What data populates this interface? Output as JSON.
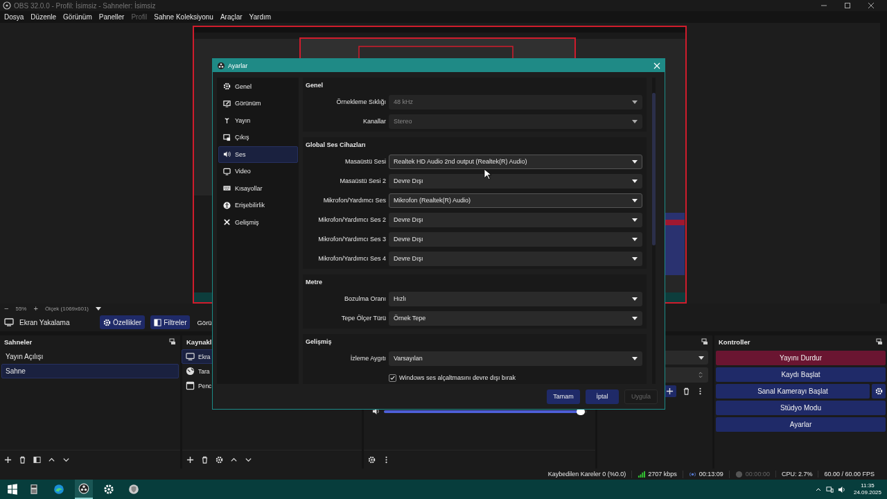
{
  "window": {
    "title": "OBS 32.0.0 - Profil: İsimsiz - Sahneler: İsimsiz"
  },
  "menu": [
    {
      "label": "Dosya",
      "disabled": false
    },
    {
      "label": "Düzenle",
      "disabled": false
    },
    {
      "label": "Görünüm",
      "disabled": false
    },
    {
      "label": "Paneller",
      "disabled": false
    },
    {
      "label": "Profil",
      "disabled": true
    },
    {
      "label": "Sahne Koleksiyonu",
      "disabled": false
    },
    {
      "label": "Araçlar",
      "disabled": false
    },
    {
      "label": "Yardım",
      "disabled": false
    }
  ],
  "preview": {
    "zoom_out": "−",
    "zoom": "55%",
    "zoom_in": "+",
    "scale": "Ölçek (1069x601)"
  },
  "source_toolbar": {
    "source": "Ekran Yakalama",
    "buttons": [
      {
        "label": "Özellikler",
        "kind": "gear"
      },
      {
        "label": "Filtreler",
        "kind": "filter"
      },
      {
        "label": "Görü",
        "kind": "plain"
      }
    ]
  },
  "scenes": {
    "title": "Sahneler",
    "items": [
      {
        "label": "Yayın Açılışı",
        "selected": false
      },
      {
        "label": "Sahne",
        "selected": true
      }
    ]
  },
  "sources": {
    "title": "Kaynakl",
    "items": [
      {
        "label": "Ekra",
        "kind": "display",
        "selected": true
      },
      {
        "label": "Tara",
        "kind": "browser",
        "selected": false
      },
      {
        "label": "Penc",
        "kind": "window",
        "selected": false
      }
    ]
  },
  "mixer": {
    "level": 0.97
  },
  "controls": {
    "title": "Kontroller",
    "buttons": [
      {
        "label": "Yayını Durdur",
        "active": true,
        "settings": false
      },
      {
        "label": "Kaydı Başlat",
        "active": false,
        "settings": false
      },
      {
        "label": "Sanal Kamerayı Başlat",
        "active": false,
        "settings": true
      },
      {
        "label": "Stüdyo Modu",
        "active": false,
        "settings": false
      },
      {
        "label": "Ayarlar",
        "active": false,
        "settings": false
      }
    ]
  },
  "status_bar": {
    "dropped": "Kaybedilen Kareler 0 (%0.0)",
    "bitrate": "2707 kbps",
    "stream_time": "00:13:09",
    "record_time": "00:00:00",
    "cpu": "CPU: 2.7%",
    "fps": "60.00 / 60.00 FPS"
  },
  "taskbar": {
    "apps": [
      {
        "kind": "calculator",
        "selected": false
      },
      {
        "kind": "edge",
        "selected": false
      },
      {
        "kind": "obs",
        "selected": true
      },
      {
        "kind": "settings",
        "selected": false
      },
      {
        "kind": "shield",
        "selected": false
      }
    ],
    "time": "11:35",
    "date": "24.09.2025"
  },
  "settings_dialog": {
    "title": "Ayarlar",
    "nav": [
      {
        "label": "Genel",
        "kind": "gear",
        "selected": false
      },
      {
        "label": "Görünüm",
        "kind": "appearance",
        "selected": false
      },
      {
        "label": "Yayın",
        "kind": "antenna",
        "selected": false
      },
      {
        "label": "Çıkış",
        "kind": "output",
        "selected": false
      },
      {
        "label": "Ses",
        "kind": "speaker",
        "selected": true
      },
      {
        "label": "Video",
        "kind": "monitor",
        "selected": false
      },
      {
        "label": "Kısayollar",
        "kind": "keyboard",
        "selected": false
      },
      {
        "label": "Erişebilirlik",
        "kind": "access",
        "selected": false
      },
      {
        "label": "Gelişmiş",
        "kind": "tools",
        "selected": false
      }
    ],
    "sections": [
      {
        "title": "Genel",
        "rows": [
          {
            "kind": "select",
            "label": "Örnekleme Sıklığı",
            "value": "48 kHz",
            "disabled": true,
            "highlighted": false
          },
          {
            "kind": "select",
            "label": "Kanallar",
            "value": "Stereo",
            "disabled": true,
            "highlighted": false
          }
        ]
      },
      {
        "title": "Global Ses Cihazları",
        "rows": [
          {
            "kind": "select",
            "label": "Masaüstü Sesi",
            "value": "Realtek HD Audio 2nd output (Realtek(R) Audio)",
            "disabled": false,
            "highlighted": true
          },
          {
            "kind": "select",
            "label": "Masaüstü Sesi 2",
            "value": "Devre Dışı",
            "disabled": false,
            "highlighted": false
          },
          {
            "kind": "select",
            "label": "Mikrofon/Yardımcı Ses",
            "value": "Mikrofon (Realtek(R) Audio)",
            "disabled": false,
            "highlighted": true
          },
          {
            "kind": "select",
            "label": "Mikrofon/Yardımcı Ses 2",
            "value": "Devre Dışı",
            "disabled": false,
            "highlighted": false
          },
          {
            "kind": "select",
            "label": "Mikrofon/Yardımcı Ses 3",
            "value": "Devre Dışı",
            "disabled": false,
            "highlighted": false
          },
          {
            "kind": "select",
            "label": "Mikrofon/Yardımcı Ses 4",
            "value": "Devre Dışı",
            "disabled": false,
            "highlighted": false
          }
        ]
      },
      {
        "title": "Metre",
        "rows": [
          {
            "kind": "select",
            "label": "Bozulma Oranı",
            "value": "Hızlı",
            "disabled": false,
            "highlighted": false
          },
          {
            "kind": "select",
            "label": "Tepe Ölçer Türü",
            "value": "Örnek Tepe",
            "disabled": false,
            "highlighted": false
          }
        ]
      },
      {
        "title": "Gelişmiş",
        "rows": [
          {
            "kind": "select",
            "label": "İzleme Aygıtı",
            "value": "Varsayılan",
            "disabled": false,
            "highlighted": false
          },
          {
            "kind": "checkbox",
            "label": "Windows ses alçaltmasını devre dışı bırak",
            "checked": true
          }
        ]
      }
    ],
    "buttons": [
      {
        "label": "Tamam",
        "disabled": false
      },
      {
        "label": "İptal",
        "disabled": false
      },
      {
        "label": "Uygula",
        "disabled": true
      }
    ]
  }
}
